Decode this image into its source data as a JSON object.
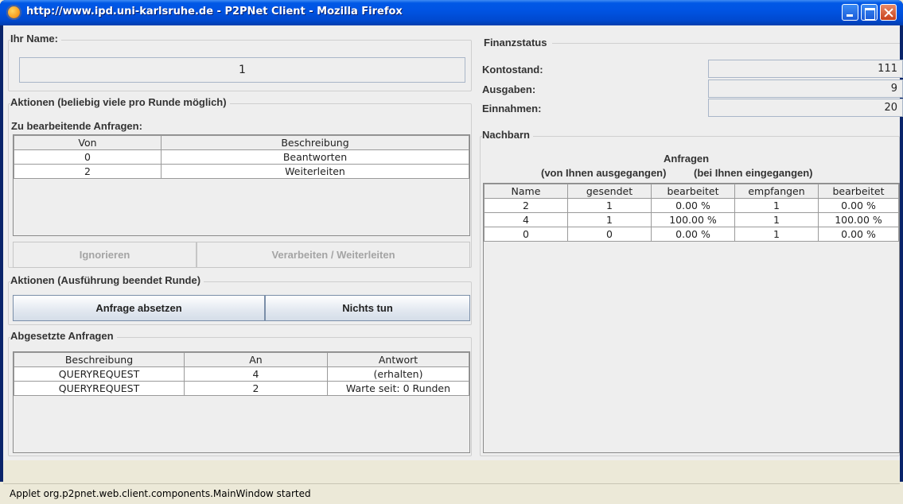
{
  "window": {
    "title": "http://www.ipd.uni-karlsruhe.de - P2PNet Client - Mozilla Firefox"
  },
  "name_section": {
    "title": "Ihr Name:",
    "value": "1"
  },
  "actions_any": {
    "title": "Aktionen (beliebig viele pro Runde möglich)",
    "requests_label": "Zu bearbeitende Anfragen:",
    "columns": [
      "Von",
      "Beschreibung"
    ],
    "rows": [
      {
        "von": "0",
        "beschreibung": "Beantworten"
      },
      {
        "von": "2",
        "beschreibung": "Weiterleiten"
      }
    ],
    "ignore_button": "Ignorieren",
    "process_button": "Verarbeiten / Weiterleiten"
  },
  "actions_end": {
    "title": "Aktionen (Ausführung beendet Runde)",
    "submit_button": "Anfrage absetzen",
    "nothing_button": "Nichts tun"
  },
  "sent_requests": {
    "title": "Abgesetzte Anfragen",
    "columns": [
      "Beschreibung",
      "An",
      "Antwort"
    ],
    "rows": [
      {
        "beschreibung": "QUERYREQUEST",
        "an": "4",
        "antwort": "(erhalten)"
      },
      {
        "beschreibung": "QUERYREQUEST",
        "an": "2",
        "antwort": "Warte seit: 0 Runden"
      }
    ]
  },
  "finance": {
    "title": "Finanzstatus",
    "balance_label": "Kontostand:",
    "balance_value": "111",
    "expenses_label": "Ausgaben:",
    "expenses_value": "9",
    "income_label": "Einnahmen:",
    "income_value": "20"
  },
  "neighbors": {
    "title": "Nachbarn",
    "header": "Anfragen",
    "subheader_out": "(von Ihnen ausgegangen)",
    "subheader_in": "(bei Ihnen eingegangen)",
    "columns": [
      "Name",
      "gesendet",
      "bearbeitet",
      "empfangen",
      "bearbeitet"
    ],
    "rows": [
      {
        "name": "2",
        "gesendet": "1",
        "bearbeitet_out": "0.00 %",
        "empfangen": "1",
        "bearbeitet_in": "0.00 %"
      },
      {
        "name": "4",
        "gesendet": "1",
        "bearbeitet_out": "100.00 %",
        "empfangen": "1",
        "bearbeitet_in": "100.00 %"
      },
      {
        "name": "0",
        "gesendet": "0",
        "bearbeitet_out": "0.00 %",
        "empfangen": "1",
        "bearbeitet_in": "0.00 %"
      }
    ]
  },
  "statusbar": {
    "text": "Applet org.p2pnet.web.client.components.MainWindow started"
  },
  "colors": {
    "titlebar": "#0054e3",
    "panel_bg": "#eeeeee"
  }
}
